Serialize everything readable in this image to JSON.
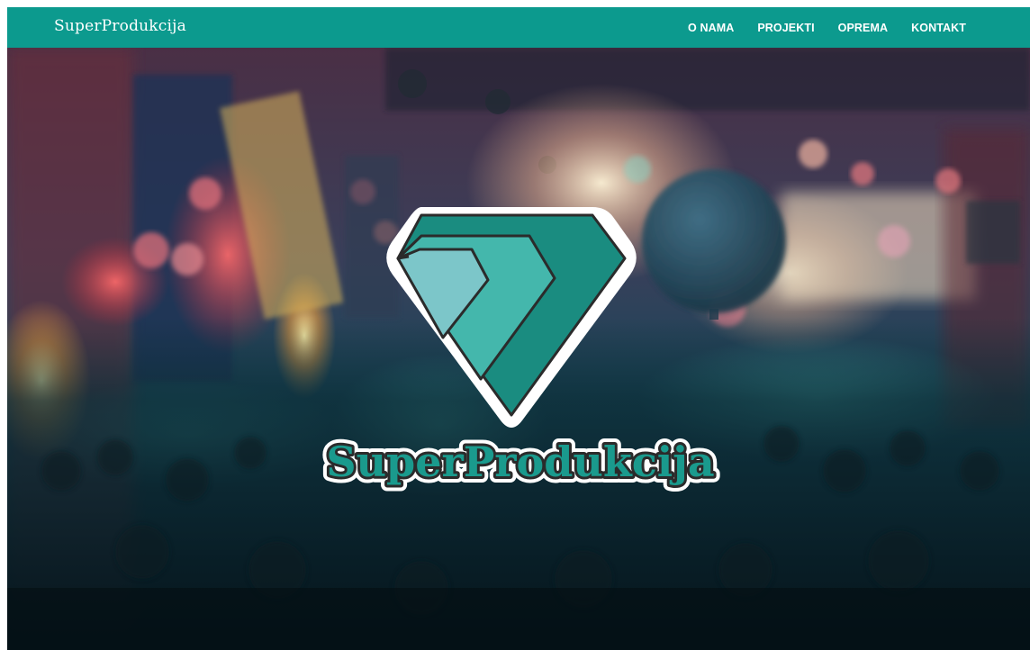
{
  "colors": {
    "nav_bg": "#0c9a8e",
    "gem_dark": "#1a8c80",
    "gem_mid": "#44b7ac",
    "gem_light": "#7cc6c9",
    "outline": "#2b2b2b"
  },
  "navbar": {
    "brand": "SuperProdukcija",
    "links": [
      {
        "label": "O NAMA"
      },
      {
        "label": "PROJEKTI"
      },
      {
        "label": "OPREMA"
      },
      {
        "label": "KONTAKT"
      }
    ]
  },
  "hero": {
    "logo_text": "SuperProdukcija",
    "logo_icon": "diamond-icon"
  }
}
